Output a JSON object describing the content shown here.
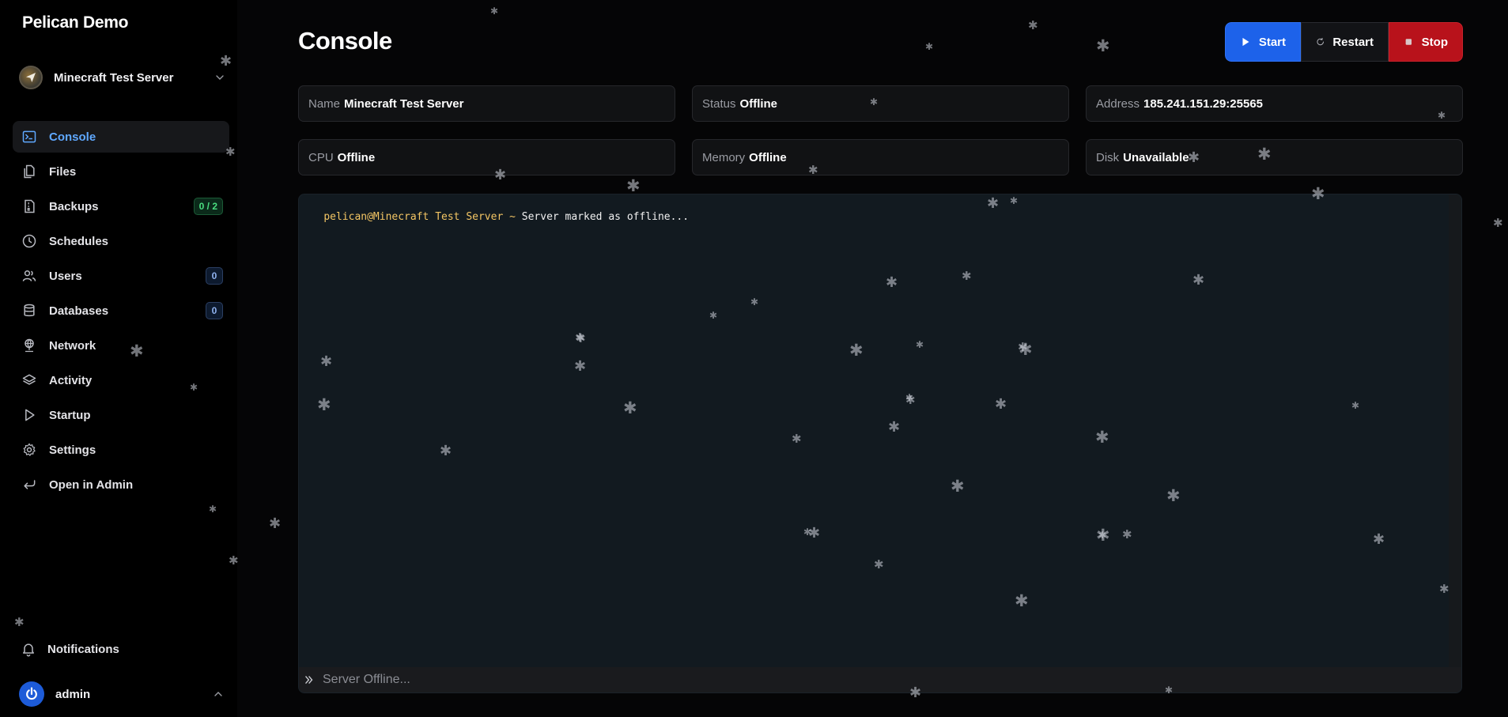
{
  "brand": "Pelican Demo",
  "server_selector": {
    "name": "Minecraft Test Server"
  },
  "nav": [
    {
      "label": "Console",
      "icon": "terminal-icon",
      "active": true
    },
    {
      "label": "Files",
      "icon": "files-icon"
    },
    {
      "label": "Backups",
      "icon": "archive-icon",
      "badge": "0 / 2",
      "badge_color": "green"
    },
    {
      "label": "Schedules",
      "icon": "clock-icon"
    },
    {
      "label": "Users",
      "icon": "users-icon",
      "badge": "0",
      "badge_color": "blue"
    },
    {
      "label": "Databases",
      "icon": "database-icon",
      "badge": "0",
      "badge_color": "blue"
    },
    {
      "label": "Network",
      "icon": "network-icon"
    },
    {
      "label": "Activity",
      "icon": "layers-icon"
    },
    {
      "label": "Startup",
      "icon": "play-icon"
    },
    {
      "label": "Settings",
      "icon": "gear-icon"
    },
    {
      "label": "Open in Admin",
      "icon": "return-icon"
    }
  ],
  "notifications_label": "Notifications",
  "user": {
    "name": "admin"
  },
  "page_title": "Console",
  "power": {
    "start": "Start",
    "restart": "Restart",
    "stop": "Stop"
  },
  "stats": [
    {
      "key": "Name",
      "value": "Minecraft Test Server"
    },
    {
      "key": "Status",
      "value": "Offline"
    },
    {
      "key": "Address",
      "value": "185.241.151.29:25565"
    },
    {
      "key": "CPU",
      "value": "Offline"
    },
    {
      "key": "Memory",
      "value": "Offline"
    },
    {
      "key": "Disk",
      "value": "Unavailable"
    }
  ],
  "console": {
    "prompt": "pelican@Minecraft Test Server ~ ",
    "message": "Server marked as offline...",
    "input_placeholder": "Server Offline..."
  },
  "colors": {
    "accent": "#1d62ea",
    "active_nav": "#5fa8ff",
    "stop": "#b8121b",
    "prompt": "#f4c664"
  }
}
